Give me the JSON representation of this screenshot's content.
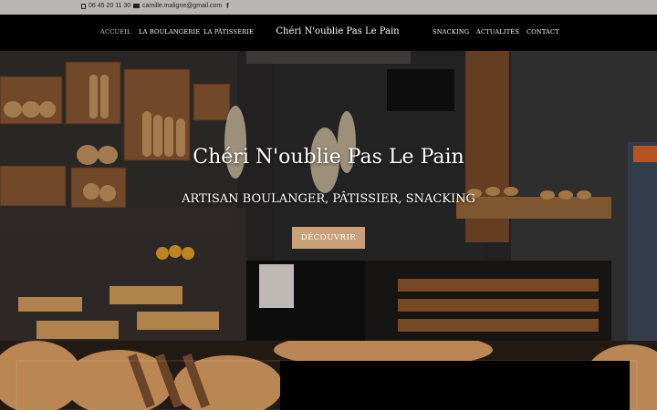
{
  "topbar": {
    "phone": "06 45 20 11 30",
    "email": "camille.maligne@gmail.com",
    "social_icon": "f"
  },
  "nav": {
    "left": [
      "ACCUEIL",
      "LA BOULANGERIE",
      "LA PÂTISSERIE"
    ],
    "brand": "Chéri N'oublie Pas Le Pain",
    "right": [
      "SNACKING",
      "ACTUALITÉS",
      "CONTACT"
    ],
    "active": "ACCUEIL"
  },
  "hero": {
    "title": "Chéri N'oublie Pas Le Pain",
    "subtitle": "ARTISAN BOULANGER, PÂTISSIER, SNACKING",
    "cta": "DÉCOUVRIR"
  },
  "colors": {
    "accent": "#c9a077",
    "topbar": "#b9b6b5",
    "header": "#000000"
  }
}
